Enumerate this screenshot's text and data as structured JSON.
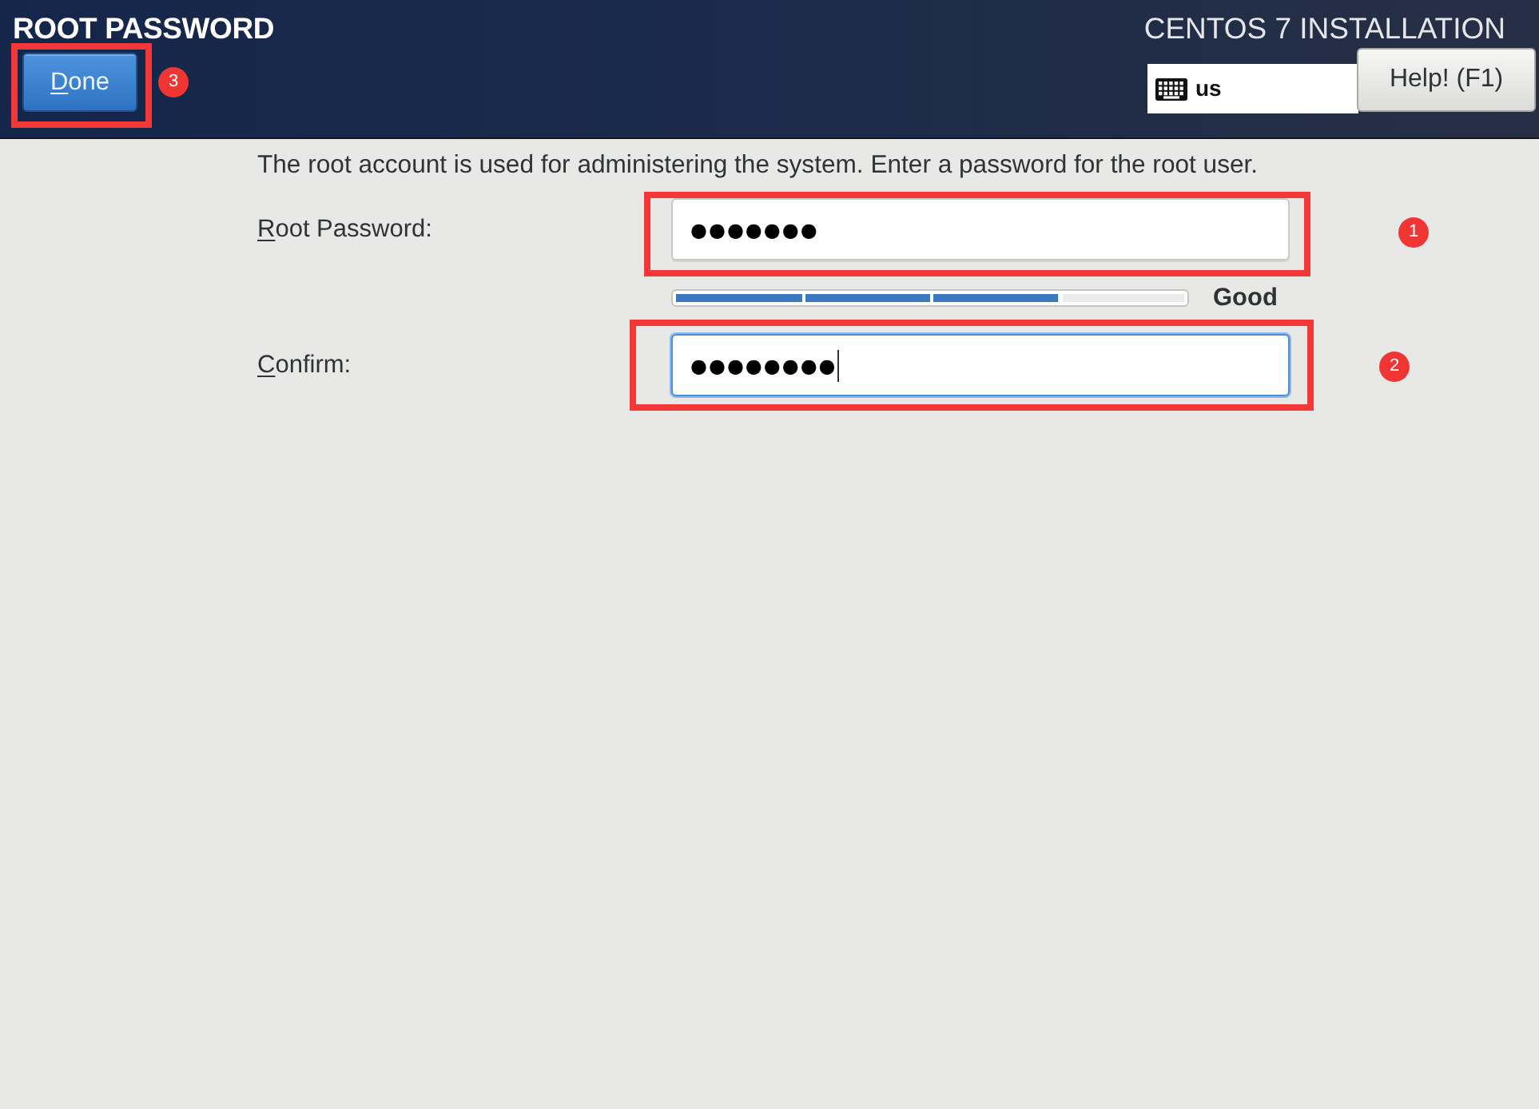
{
  "header": {
    "title": "ROOT PASSWORD",
    "done_button": {
      "label": "Done",
      "mnemonic": true,
      "annotation": "3"
    },
    "product": "CENTOS 7 INSTALLATION",
    "keyboard_layout": "us",
    "help_button": "Help! (F1)"
  },
  "description": "The root account is used for administering the system.  Enter a password for the root user.",
  "fields": [
    {
      "label": "Root Password:",
      "mnemonic": true,
      "value": "●●●●●●●",
      "focused": false,
      "annotation": "1"
    },
    {
      "label": "Confirm:",
      "mnemonic": true,
      "value": "●●●●●●●●",
      "focused": true,
      "annotation": "2"
    }
  ],
  "strength": {
    "level": 0.75,
    "reading": "Good"
  }
}
